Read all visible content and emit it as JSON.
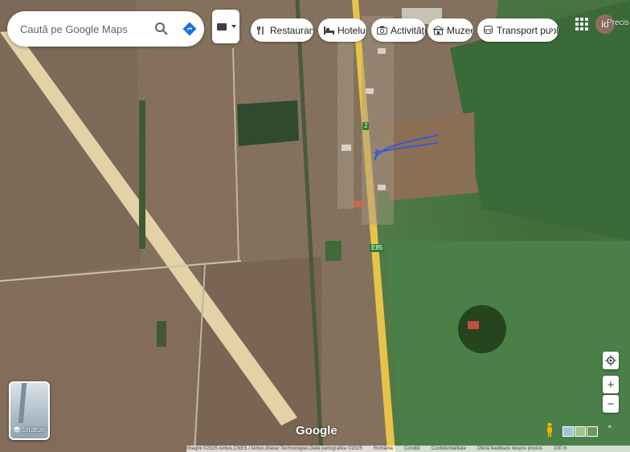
{
  "search": {
    "placeholder": "Caută pe Google Maps"
  },
  "icons": {
    "search": "search-icon",
    "directions": "directions-icon",
    "layers": "layers-icon",
    "apps": "apps-grid-icon",
    "restaurant": "cutlery-icon",
    "hotel": "bed-icon",
    "activities": "camera-icon",
    "museum": "museum-icon",
    "transit": "bus-icon",
    "next": "chevron-right-icon"
  },
  "chips": [
    {
      "label": "Restaurante"
    },
    {
      "label": "Hoteluri"
    },
    {
      "label": "Activități"
    },
    {
      "label": "Muzee"
    },
    {
      "label": "Transport public"
    }
  ],
  "account": {
    "initials": "io"
  },
  "map": {
    "corner_label": "Precis",
    "road_labels": [
      "2",
      "E85"
    ],
    "drawn_route_color": "#3b57d6",
    "main_road_color": "#e8c34a"
  },
  "layers_button": {
    "label": "Straturi"
  },
  "zoom": {
    "in_label": "+",
    "out_label": "−"
  },
  "branding": {
    "logo": "Google"
  },
  "attribution": {
    "imagery": "Imagini ©2025 Airbus,CNES / Airbus,Maxar Technologies,Date cartografice ©2025",
    "country": "România",
    "terms": "Condiții",
    "privacy": "Confidențialitate",
    "feedback": "Oferă feedback despre produs",
    "scale": "100 m"
  }
}
